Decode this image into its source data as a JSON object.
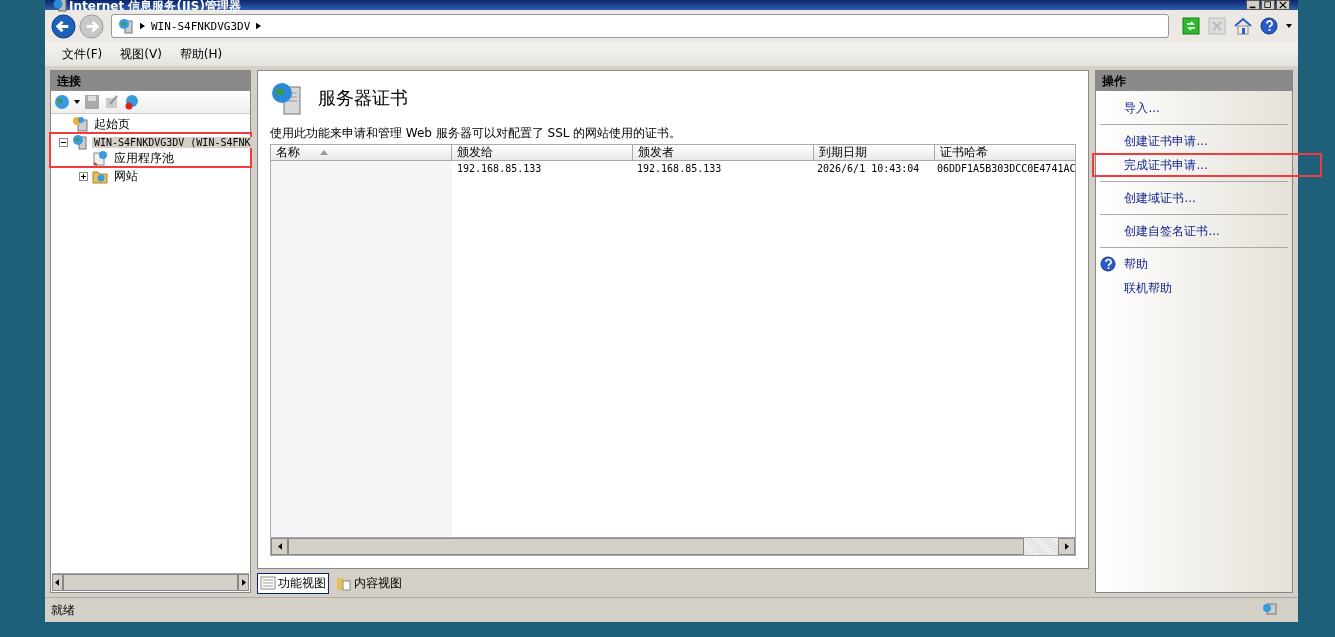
{
  "window": {
    "title": "Internet 信息服务(IIS)管理器"
  },
  "address": {
    "segments": [
      "WIN-S4FNKDVG3DV"
    ]
  },
  "menu": [
    "文件(F)",
    "视图(V)",
    "帮助(H)"
  ],
  "connections": {
    "title": "连接",
    "tree": [
      {
        "label": "起始页",
        "kind": "start",
        "selected": false,
        "annotated": false
      },
      {
        "label": "WIN-S4FNKDVG3DV (WIN-S4FNK",
        "kind": "server",
        "selected": true,
        "annotated": true,
        "expanded": true,
        "children": [
          {
            "label": "应用程序池",
            "kind": "pool",
            "selected": false,
            "annotated": true
          },
          {
            "label": "网站",
            "kind": "sites",
            "selected": false,
            "annotated": false,
            "expanded": false
          }
        ]
      }
    ]
  },
  "feature": {
    "title": "服务器证书",
    "description": "使用此功能来申请和管理 Web 服务器可以对配置了 SSL 的网站使用的证书。",
    "table": {
      "columns": [
        {
          "label": "名称",
          "sorted": true
        },
        {
          "label": "颁发给",
          "sorted": false
        },
        {
          "label": "颁发者",
          "sorted": false
        },
        {
          "label": "到期日期",
          "sorted": false
        },
        {
          "label": "证书哈希",
          "sorted": false
        }
      ],
      "rows": [
        [
          "",
          "192.168.85.133",
          "192.168.85.133",
          "2026/6/1 10:43:04",
          "06DDF1A5B303DCC0E4741AC"
        ]
      ]
    },
    "views": [
      {
        "label": "功能视图",
        "selected": true
      },
      {
        "label": "内容视图",
        "selected": false
      }
    ]
  },
  "actions": {
    "title": "操作",
    "groups": [
      [
        {
          "label": "导入...",
          "kind": "link",
          "annotated": false
        }
      ],
      [
        {
          "label": "创建证书申请...",
          "kind": "link",
          "annotated": false
        },
        {
          "label": "完成证书申请...",
          "kind": "link",
          "annotated": true
        }
      ],
      [
        {
          "label": "创建域证书...",
          "kind": "link",
          "annotated": false
        }
      ],
      [
        {
          "label": "创建自签名证书...",
          "kind": "link",
          "annotated": false
        }
      ],
      [
        {
          "label": "帮助",
          "kind": "help",
          "annotated": false
        },
        {
          "label": "联机帮助",
          "kind": "link",
          "annotated": false
        }
      ]
    ]
  },
  "status_bar": {
    "text": "就绪"
  }
}
